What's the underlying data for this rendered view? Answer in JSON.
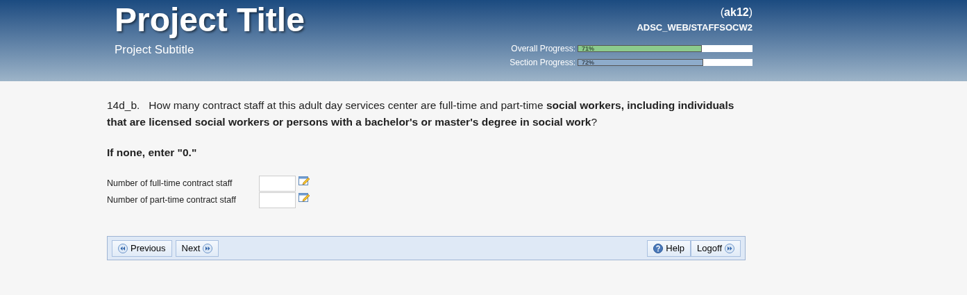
{
  "header": {
    "title": "Project Title",
    "subtitle": "Project Subtitle",
    "user": "(**ak12**)",
    "path": "ADSC_WEB/STAFFSOCW2",
    "progress": [
      {
        "label": "Overall Progress:",
        "level": 0.71,
        "reading": "71%",
        "color": "#8ccb8c"
      },
      {
        "label": "Section Progress:",
        "level": 0.72,
        "reading": "72%",
        "color": "#8eaccb"
      }
    ]
  },
  "question": {
    "number": "14d_b.",
    "text": "How many contract staff at this adult day services center are full-time and part-time **social workers, including individuals that are licensed social workers or persons with a bachelor's or master's degree in social work**?",
    "instruction": "If none, enter \"0.\""
  },
  "fields": [
    {
      "label": "Number of full-time contract staff"
    },
    {
      "label": "Number of part-time contract staff"
    }
  ],
  "nav_left": [
    {
      "label": "Previous",
      "kind": "back"
    },
    {
      "label": "Next",
      "kind": "forward"
    }
  ],
  "nav_right": [
    {
      "label": "Help",
      "kind": "help"
    },
    {
      "label": "Logoff",
      "kind": "forward"
    }
  ]
}
